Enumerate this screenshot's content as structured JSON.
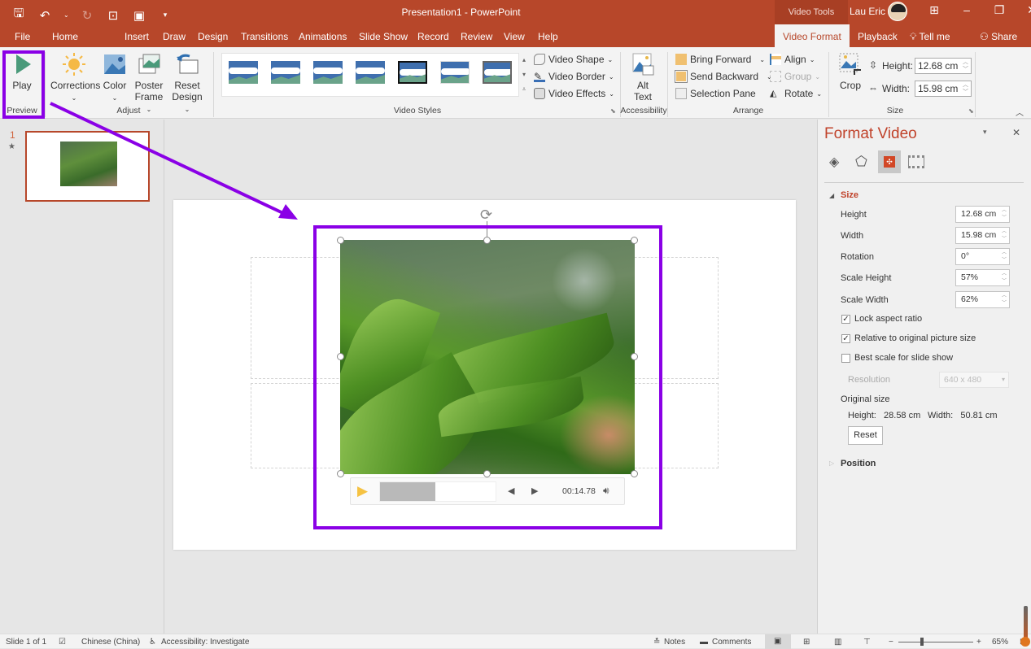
{
  "app": {
    "title": "Presentation1  -  PowerPoint",
    "context_tab_group": "Video Tools",
    "user_name": "Lau Eric"
  },
  "quick_access": {
    "icons": [
      "save-icon",
      "undo-icon",
      "undo-dropdown-icon",
      "redo-icon",
      "present-from-beginning-icon",
      "layout-icon",
      "customize-qat-icon"
    ]
  },
  "window": {
    "ribbon_display_icon": "ribbon-display-options-icon",
    "minimize": "–",
    "restore": "❐",
    "close": "✕"
  },
  "tabs": [
    {
      "label": "File"
    },
    {
      "label": "Home"
    },
    {
      "label": "Insert"
    },
    {
      "label": "Draw"
    },
    {
      "label": "Design"
    },
    {
      "label": "Transitions"
    },
    {
      "label": "Animations"
    },
    {
      "label": "Slide Show"
    },
    {
      "label": "Record"
    },
    {
      "label": "Review"
    },
    {
      "label": "View"
    },
    {
      "label": "Help"
    },
    {
      "label": "Video Format"
    },
    {
      "label": "Playback"
    }
  ],
  "tell_me": "Tell me",
  "share": "Share",
  "ribbon": {
    "preview": {
      "group_label": "Preview",
      "play": "Play"
    },
    "adjust": {
      "group_label": "Adjust",
      "corrections": "Corrections",
      "color": "Color",
      "poster_frame_1": "Poster",
      "poster_frame_2": "Frame",
      "reset_design_1": "Reset",
      "reset_design_2": "Design"
    },
    "video_styles": {
      "group_label": "Video Styles",
      "video_shape": "Video Shape",
      "video_border": "Video Border",
      "video_effects": "Video Effects",
      "style_count": 7,
      "selected_style_index": 4
    },
    "accessibility": {
      "group_label": "Accessibility",
      "alt_text_1": "Alt",
      "alt_text_2": "Text"
    },
    "arrange": {
      "group_label": "Arrange",
      "bring_forward": "Bring Forward",
      "send_backward": "Send Backward",
      "selection_pane": "Selection Pane",
      "align": "Align",
      "group": "Group",
      "rotate": "Rotate"
    },
    "size": {
      "group_label": "Size",
      "crop": "Crop",
      "height_label": "Height:",
      "height_value": "12.68 cm",
      "width_label": "Width:",
      "width_value": "15.98 cm"
    }
  },
  "thumbnails": [
    {
      "number": "1",
      "has_animation_star": true
    }
  ],
  "video_controls": {
    "time": "00:14.78",
    "progress_fraction": 0.48
  },
  "format_pane": {
    "title": "Format Video",
    "tabs": [
      "fill-line-icon",
      "effects-pentagon-icon",
      "size-properties-icon",
      "video-icon"
    ],
    "size_section": "Size",
    "fields": [
      {
        "label": "Height",
        "value": "12.68 cm"
      },
      {
        "label": "Width",
        "value": "15.98 cm"
      },
      {
        "label": "Rotation",
        "value": "0°"
      },
      {
        "label": "Scale Height",
        "value": "57%"
      },
      {
        "label": "Scale Width",
        "value": "62%"
      }
    ],
    "checkboxes": [
      {
        "label": "Lock aspect ratio",
        "checked": true
      },
      {
        "label": "Relative to original picture size",
        "checked": true
      },
      {
        "label": "Best scale for slide show",
        "checked": false
      }
    ],
    "resolution_label": "Resolution",
    "resolution_value": "640 x 480",
    "original_size_label": "Original size",
    "original_height": "Height:   28.58 cm",
    "original_width": "Width:   50.81 cm",
    "reset": "Reset",
    "position_section": "Position"
  },
  "status": {
    "slide": "Slide 1 of 1",
    "language": "Chinese (China)",
    "accessibility": "Accessibility: Investigate",
    "notes": "Notes",
    "comments": "Comments",
    "zoom": "65%",
    "zoom_minus": "−",
    "zoom_plus": "+"
  },
  "annotation_color": "#8a00e6",
  "accent": "#b7472a"
}
